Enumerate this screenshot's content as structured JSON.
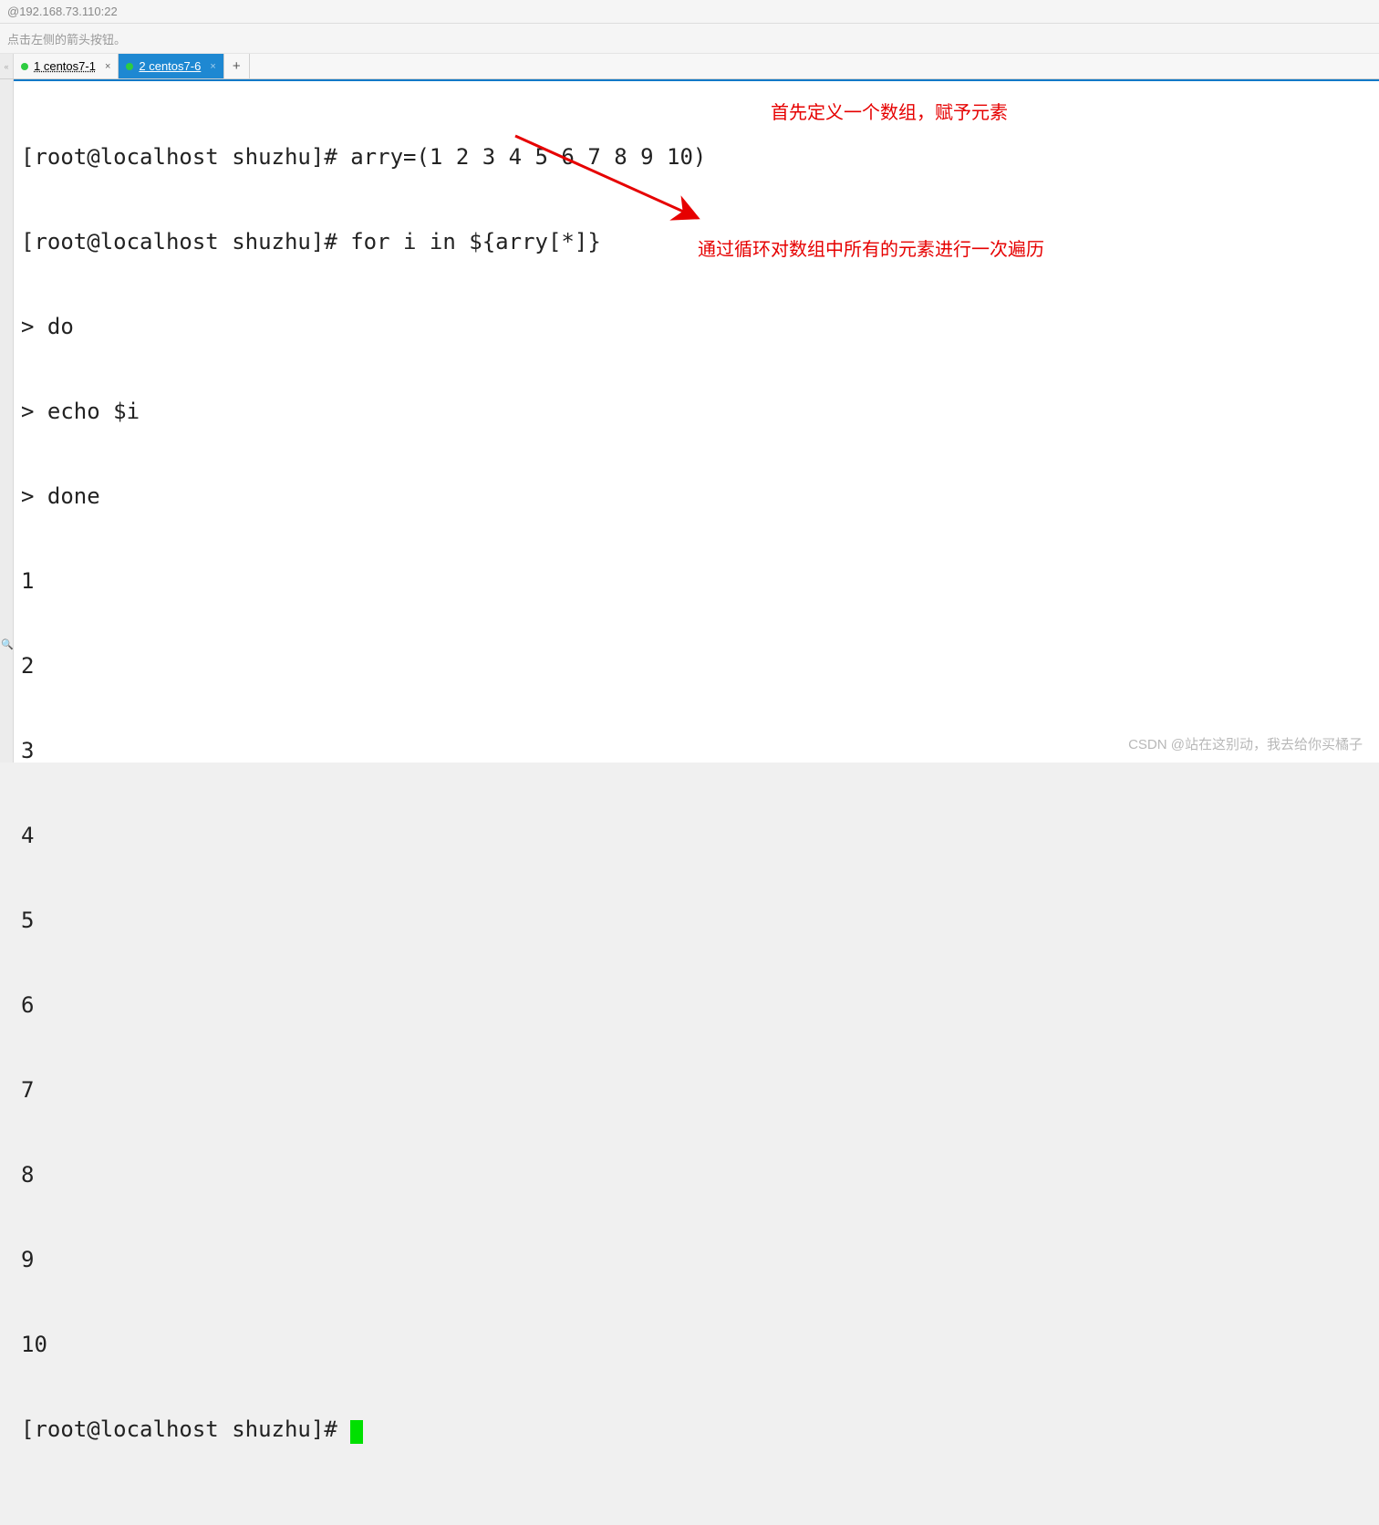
{
  "title_bar": "@192.168.73.110:22",
  "hint": "点击左侧的箭头按钮。",
  "tabs": [
    {
      "label": "1 centos7-1",
      "active": false
    },
    {
      "label": "2 centos7-6",
      "active": true
    }
  ],
  "add_tab": "+",
  "gutter_chevron": "«",
  "terminal": {
    "prompt": "[root@localhost shuzhu]# ",
    "lines": [
      "[root@localhost shuzhu]# arry=(1 2 3 4 5 6 7 8 9 10)",
      "[root@localhost shuzhu]# for i in ${arry[*]}",
      "> do",
      "> echo $i",
      "> done",
      "1",
      "2",
      "3",
      "4",
      "5",
      "6",
      "7",
      "8",
      "9",
      "10"
    ],
    "prompt_line": "[root@localhost shuzhu]# "
  },
  "annotations": {
    "a1": "首先定义一个数组，赋予元素",
    "a2": "通过循环对数组中所有的元素进行一次遍历"
  },
  "watermark": "CSDN @站在这别动，我去给你买橘子"
}
